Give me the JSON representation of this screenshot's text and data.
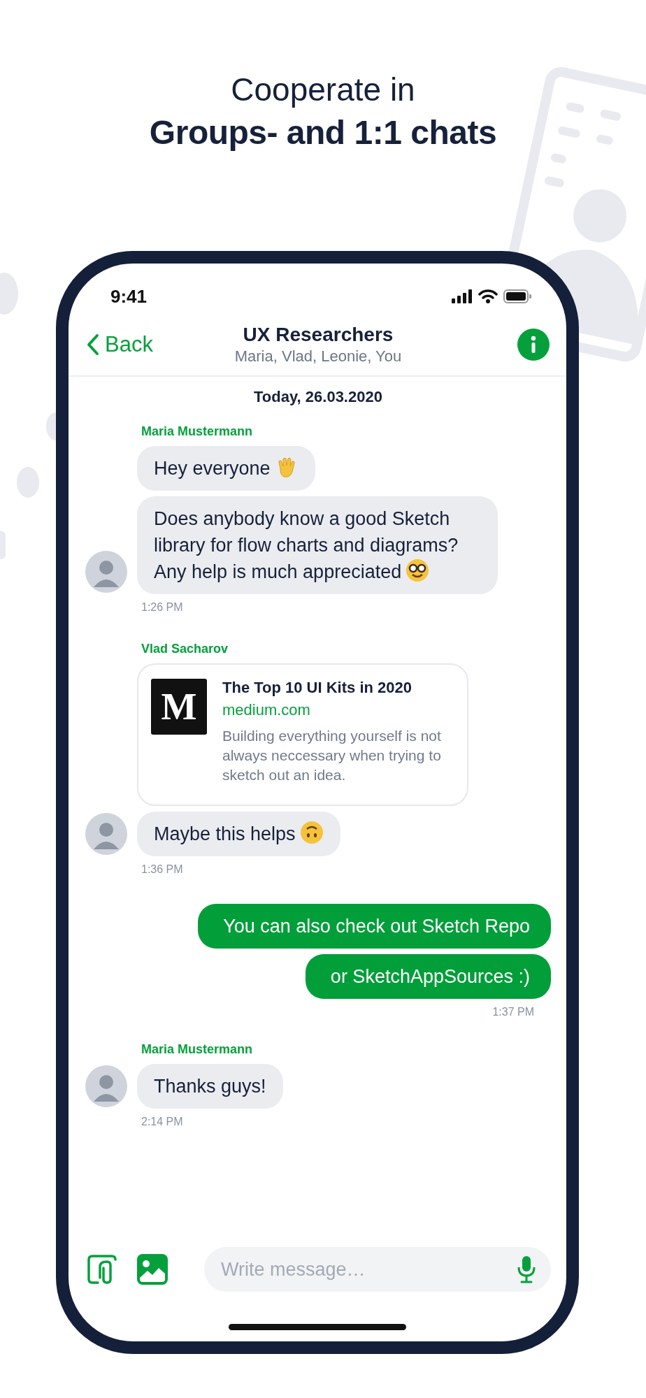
{
  "headline": {
    "line_1": "Cooperate in",
    "line_2": "Groups- and 1:1 chats"
  },
  "status_bar": {
    "time": "9:41"
  },
  "nav": {
    "back": "Back",
    "title": "UX Researchers",
    "subtitle": "Maria, Vlad, Leonie, You"
  },
  "date": "Today, 26.03.2020",
  "messages": [
    {
      "kind": "incoming",
      "sender": "Maria Mustermann",
      "bubbles": [
        {
          "kind": "text",
          "text": "Hey everyone",
          "emoji": {
            "kind": "wave"
          }
        },
        {
          "kind": "text",
          "text": "Does anybody know a good Sketch library for flow charts and diagrams? Any help is much appreciated",
          "emoji": {
            "kind": "nerd"
          }
        }
      ],
      "time": "1:26 PM"
    },
    {
      "kind": "incoming",
      "sender": "Vlad Sacharov",
      "bubbles": [
        {
          "kind": "link",
          "logo": "M",
          "title": "The Top 10 UI Kits in 2020",
          "domain": "medium.com",
          "description": "Building everything yourself is not always neccessary when trying to sketch out an idea."
        },
        {
          "kind": "text",
          "text": "Maybe this helps",
          "emoji": {
            "kind": "upside_down"
          }
        }
      ],
      "time": "1:36 PM"
    },
    {
      "kind": "outgoing",
      "bubbles": [
        {
          "kind": "text",
          "text": "You can also check out Sketch Repo"
        },
        {
          "kind": "text",
          "text": "or SketchAppSources :)"
        }
      ],
      "time": "1:37 PM"
    },
    {
      "kind": "incoming",
      "sender": "Maria Mustermann",
      "bubbles": [
        {
          "kind": "text",
          "text": "Thanks guys!"
        }
      ],
      "time": "2:14 PM"
    }
  ],
  "composer": {
    "placeholder": "Write message…"
  }
}
